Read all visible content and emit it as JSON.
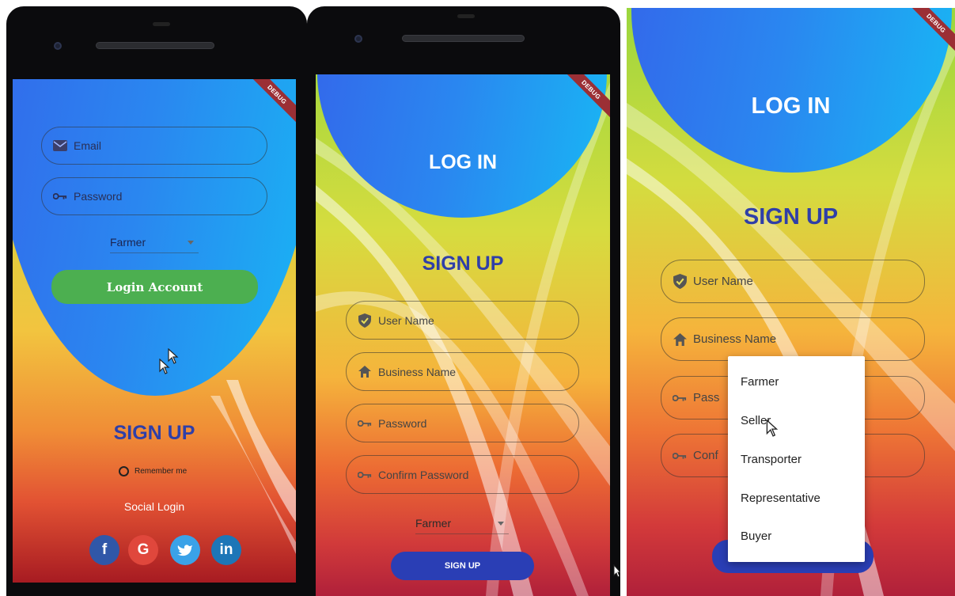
{
  "phone1": {
    "debug_banner": "DEBUG",
    "email_placeholder": "Email",
    "password_placeholder": "Password",
    "role_selected": "Farmer",
    "login_button": "Login Account",
    "signup_title": "SIGN UP",
    "remember_me": "Remember me",
    "social_login": "Social Login",
    "social_icons": [
      "facebook-icon",
      "google-icon",
      "twitter-icon",
      "linkedin-icon"
    ],
    "social_labels": [
      "f",
      "G",
      "",
      "in"
    ]
  },
  "phone2": {
    "debug_banner": "DEBUG",
    "login_title": "LOG IN",
    "signup_title": "SIGN UP",
    "fields": [
      "User Name",
      "Business Name",
      "Password",
      "Confirm Password"
    ],
    "role_selected": "Farmer",
    "signup_button": "SIGN UP"
  },
  "phone3": {
    "debug_banner": "DEBUG",
    "login_title": "LOG IN",
    "signup_title": "SIGN UP",
    "fields": [
      "User Name",
      "Business Name",
      "Pass",
      "Conf"
    ],
    "role_menu": [
      "Farmer",
      "Seller",
      "Transporter",
      "Representative",
      "Buyer"
    ]
  },
  "colors": {
    "circle_blue": "#2a87f0",
    "signup_blue": "#2f3fa8",
    "login_green": "#4caf50",
    "signup_button": "#2a3eb5",
    "debug_red": "#9b2f35"
  }
}
